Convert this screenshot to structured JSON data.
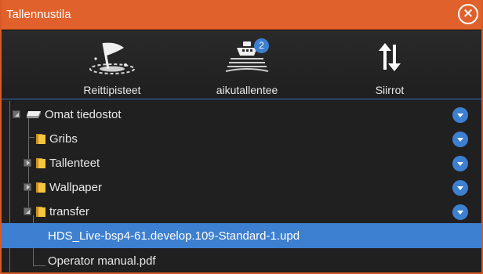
{
  "window": {
    "title": "Tallennustila",
    "close_icon": "close-circle-icon",
    "accent_color": "#e0612b"
  },
  "toolbar": {
    "items": [
      {
        "label": "Reittipisteet",
        "icon": "waypoint-flag-icon"
      },
      {
        "label": "aikutallentee",
        "icon": "boat-recording-icon",
        "badge": "2"
      },
      {
        "label": "Siirrot",
        "icon": "transfer-arrows-icon"
      }
    ]
  },
  "tree": {
    "selection_color": "#3d7fd0",
    "rows": [
      {
        "label": "Omat tiedostot",
        "icon": "storage-drive-icon",
        "expander": "open",
        "menu": true
      },
      {
        "label": "Gribs",
        "icon": "folder-icon",
        "expander": "none",
        "menu": true
      },
      {
        "label": "Tallenteet",
        "icon": "folder-icon",
        "expander": "closed",
        "menu": true
      },
      {
        "label": "Wallpaper",
        "icon": "folder-icon",
        "expander": "closed",
        "menu": true
      },
      {
        "label": "transfer",
        "icon": "folder-icon",
        "expander": "open",
        "menu": true
      },
      {
        "label": "HDS_Live-bsp4-61.develop.109-Standard-1.upd",
        "icon": "file-icon",
        "expander": "none",
        "menu": false,
        "selected": true
      },
      {
        "label": "Operator manual.pdf",
        "icon": "file-icon",
        "expander": "none",
        "menu": false
      }
    ]
  }
}
